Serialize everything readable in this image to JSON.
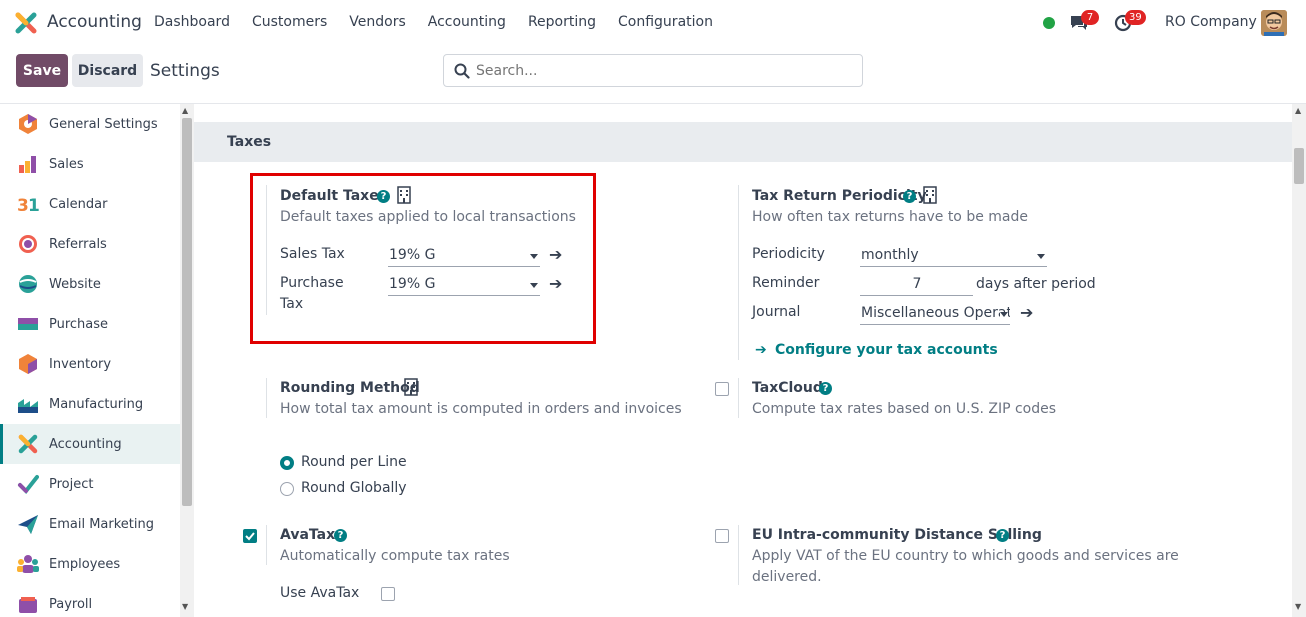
{
  "navbar": {
    "app_name": "Accounting",
    "menu": [
      "Dashboard",
      "Customers",
      "Vendors",
      "Accounting",
      "Reporting",
      "Configuration"
    ],
    "messages_count": "7",
    "activities_count": "39",
    "company": "RO Company"
  },
  "control": {
    "save_label": "Save",
    "discard_label": "Discard",
    "title": "Settings",
    "search_placeholder": "Search..."
  },
  "sidebar": {
    "items": [
      {
        "label": "General Settings",
        "icon": "general-settings-icon"
      },
      {
        "label": "Sales",
        "icon": "sales-icon"
      },
      {
        "label": "Calendar",
        "icon": "calendar-icon"
      },
      {
        "label": "Referrals",
        "icon": "referrals-icon"
      },
      {
        "label": "Website",
        "icon": "website-icon"
      },
      {
        "label": "Purchase",
        "icon": "purchase-icon"
      },
      {
        "label": "Inventory",
        "icon": "inventory-icon"
      },
      {
        "label": "Manufacturing",
        "icon": "manufacturing-icon"
      },
      {
        "label": "Accounting",
        "icon": "accounting-icon",
        "active": true
      },
      {
        "label": "Project",
        "icon": "project-icon"
      },
      {
        "label": "Email Marketing",
        "icon": "email-marketing-icon"
      },
      {
        "label": "Employees",
        "icon": "employees-icon"
      },
      {
        "label": "Payroll",
        "icon": "payroll-icon"
      }
    ]
  },
  "section": {
    "title": "Taxes"
  },
  "default_taxes": {
    "title": "Default Taxes",
    "desc": "Default taxes applied to local transactions",
    "sales_tax_label": "Sales Tax",
    "sales_tax_value": "19% G",
    "purchase_tax_label_1": "Purchase",
    "purchase_tax_label_2": "Tax",
    "purchase_tax_value": "19% G"
  },
  "tax_return": {
    "title": "Tax Return Periodicity",
    "desc": "How often tax returns have to be made",
    "periodicity_label": "Periodicity",
    "periodicity_value": "monthly",
    "reminder_label": "Reminder",
    "reminder_value": "7",
    "reminder_suffix": "days after period",
    "journal_label": "Journal",
    "journal_value": "Miscellaneous Operat",
    "configure_link": "Configure your tax accounts"
  },
  "rounding": {
    "title": "Rounding Method",
    "desc": "How total tax amount is computed in orders and invoices",
    "option_line": "Round per Line",
    "option_global": "Round Globally"
  },
  "taxcloud": {
    "title": "TaxCloud",
    "desc": "Compute tax rates based on U.S. ZIP codes"
  },
  "avatax": {
    "title": "AvaTax",
    "desc": "Automatically compute tax rates",
    "use_label": "Use AvaTax"
  },
  "eu_distance": {
    "title": "EU Intra-community Distance Selling",
    "desc_1": "Apply VAT of the EU country to which goods and services are",
    "desc_2": "delivered."
  },
  "colors": {
    "brand": "#714b67",
    "accent": "#017e84",
    "highlight": "#e00000"
  }
}
